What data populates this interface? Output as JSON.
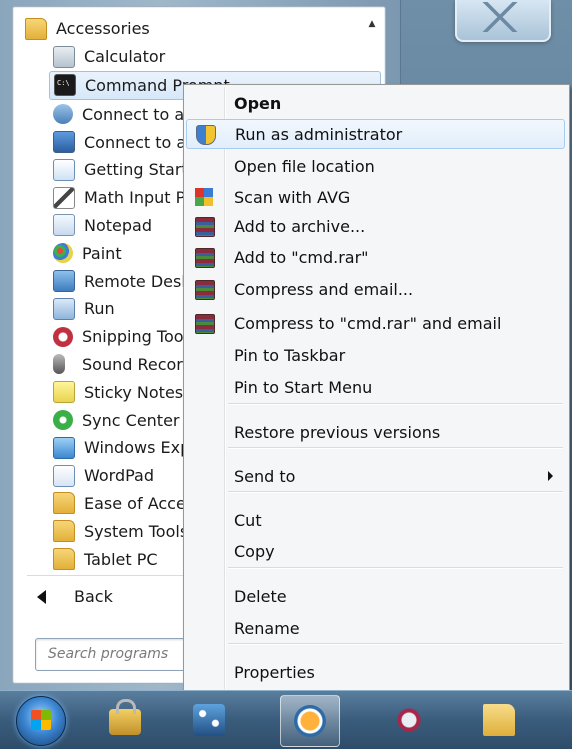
{
  "start_menu": {
    "programs": [
      {
        "label": "Accessories",
        "icon": "folder-icon",
        "kind": "folder",
        "root": true
      },
      {
        "label": "Calculator",
        "icon": "calculator-icon",
        "kind": "calc"
      },
      {
        "label": "Command Prompt",
        "icon": "command-prompt-icon",
        "kind": "cmd",
        "selected": true
      },
      {
        "label": "Connect to a",
        "icon": "network-projector-icon",
        "kind": "net"
      },
      {
        "label": "Connect to a",
        "icon": "projector-screen-icon",
        "kind": "screen"
      },
      {
        "label": "Getting Starte",
        "icon": "getting-started-icon",
        "kind": "doc"
      },
      {
        "label": "Math Input P",
        "icon": "math-input-pen-icon",
        "kind": "pen"
      },
      {
        "label": "Notepad",
        "icon": "notepad-icon",
        "kind": "note"
      },
      {
        "label": "Paint",
        "icon": "paint-palette-icon",
        "kind": "paint"
      },
      {
        "label": "Remote Desk",
        "icon": "remote-desktop-icon",
        "kind": "remote"
      },
      {
        "label": "Run",
        "icon": "run-icon",
        "kind": "run"
      },
      {
        "label": "Snipping Too",
        "icon": "snipping-tool-icon",
        "kind": "snip"
      },
      {
        "label": "Sound Recor",
        "icon": "microphone-icon",
        "kind": "sound"
      },
      {
        "label": "Sticky Notes",
        "icon": "sticky-notes-icon",
        "kind": "sticky"
      },
      {
        "label": "Sync Center",
        "icon": "sync-center-icon",
        "kind": "sync"
      },
      {
        "label": "Windows Exp",
        "icon": "windows-explorer-icon",
        "kind": "explorer"
      },
      {
        "label": "WordPad",
        "icon": "wordpad-icon",
        "kind": "wordpad"
      },
      {
        "label": "Ease of Acces",
        "icon": "folder-icon",
        "kind": "folder"
      },
      {
        "label": "System Tools",
        "icon": "folder-icon",
        "kind": "folder"
      },
      {
        "label": "Tablet PC",
        "icon": "folder-icon",
        "kind": "folder"
      }
    ],
    "back_label": "Back",
    "search_placeholder": "Search programs"
  },
  "context_menu": {
    "items": [
      {
        "label": "Open",
        "bold": true
      },
      {
        "label": "Run as administrator",
        "icon": "uac-shield-icon",
        "hover": true
      },
      {
        "label": "Open file location"
      },
      {
        "label": "Scan with AVG",
        "icon": "avg-icon"
      },
      {
        "label": "Add to archive...",
        "icon": "winrar-icon"
      },
      {
        "label": "Add to \"cmd.rar\"",
        "icon": "winrar-icon"
      },
      {
        "label": "Compress and email...",
        "icon": "winrar-icon"
      },
      {
        "label": "Compress to \"cmd.rar\" and email",
        "icon": "winrar-icon"
      },
      {
        "label": "Pin to Taskbar"
      },
      {
        "label": "Pin to Start Menu"
      },
      {
        "label": "Restore previous versions"
      },
      {
        "label": "Send to",
        "submenu": true
      },
      {
        "label": "Cut"
      },
      {
        "label": "Copy"
      },
      {
        "label": "Delete"
      },
      {
        "label": "Rename"
      },
      {
        "label": "Properties"
      }
    ]
  },
  "taskbar": {
    "items": [
      {
        "name": "start-orb",
        "icon": "windows-logo-icon"
      },
      {
        "name": "taskbar-lock",
        "icon": "padlock-icon"
      },
      {
        "name": "taskbar-network",
        "icon": "network-icon"
      },
      {
        "name": "taskbar-media-player",
        "icon": "media-player-icon",
        "active": true
      },
      {
        "name": "taskbar-snipping-tool",
        "icon": "snipping-tool-icon"
      },
      {
        "name": "taskbar-explorer",
        "icon": "folder-icon"
      }
    ]
  }
}
